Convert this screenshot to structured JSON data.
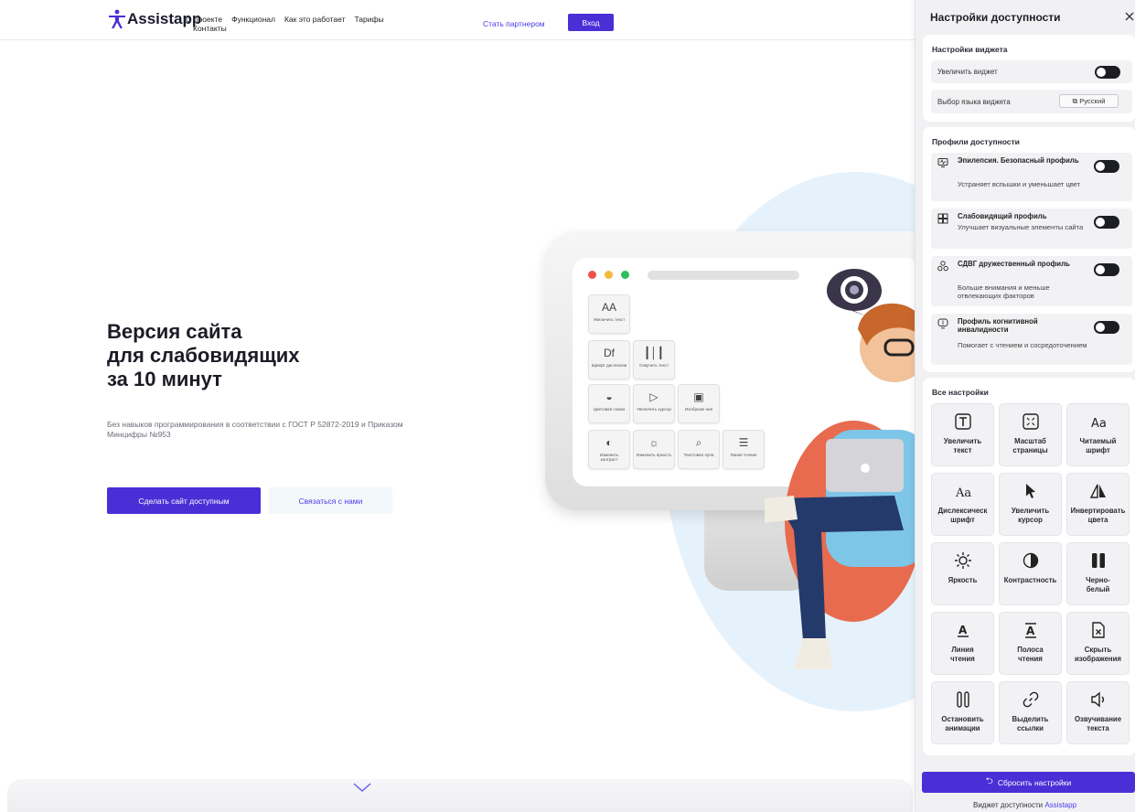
{
  "header": {
    "logo_text": "Assistapp",
    "nav": [
      "О проекте",
      "Функционал",
      "Как это работает",
      "Тарифы"
    ],
    "nav_line2": "Контакты",
    "partner_link": "Стать партнером",
    "login": "Вход"
  },
  "hero": {
    "title_lines": [
      "Версия сайта",
      "для слабовидящих",
      "за 10 минут"
    ],
    "subtitle": "Без навыков программирования в соответствии с ГОСТ Р 52872-2019 и Приказом Минцифры №953",
    "cta_primary": "Сделать сайт доступным",
    "cta_secondary": "Связаться с нами"
  },
  "illustration": {
    "tiles": [
      {
        "glyph": "AA",
        "label": "Увеличить текст"
      },
      {
        "glyph": "Df",
        "label": "Шрифт дислексии"
      },
      {
        "glyph": "┃│┃",
        "label": "Озвучить текст"
      },
      {
        "glyph": "◒",
        "label": "Цветовая схема"
      },
      {
        "glyph": "▷",
        "label": "Увеличить курсор"
      },
      {
        "glyph": "▣",
        "label": "Изображе ния"
      },
      {
        "glyph": "◐",
        "label": "Изменить контраст"
      },
      {
        "glyph": "☼",
        "label": "Изменить яркость"
      },
      {
        "glyph": "⌕",
        "label": "Текстовая лупа"
      },
      {
        "glyph": "☰",
        "label": "Линия чтения"
      }
    ]
  },
  "panel": {
    "title": "Настройки доступности",
    "widget_section": {
      "title": "Настройки виджета",
      "enlarge_label": "Увеличить виджет",
      "language_label": "Выбор языка виджета",
      "language_value": "Русский"
    },
    "profiles_section": {
      "title": "Профили доступности",
      "profiles": [
        {
          "name": "Эпилепсия. Безопасный профиль",
          "desc": "Устраняет вспышки и уменьшает цвет",
          "icon": "monitor-pulse-icon"
        },
        {
          "name": "Слабовидящий профиль",
          "desc": "Улучшает визуальные элементы сайта",
          "icon": "layout-icon"
        },
        {
          "name": "СДВГ дружественный профиль",
          "desc": "Больше внимания и меньше отвлекающих факторов",
          "icon": "cluster-icon"
        },
        {
          "name": "Профиль когнитивной инвалидности",
          "desc": "Помогает с чтением и сосредоточением",
          "icon": "brain-monitor-icon"
        }
      ]
    },
    "all_settings": {
      "title": "Все настройки",
      "tiles": [
        {
          "label": "Увеличить\nтекст",
          "icon": "text-size-icon"
        },
        {
          "label": "Масштаб\nстраницы",
          "icon": "scale-icon"
        },
        {
          "label": "Читаемый\nшрифт",
          "icon": "readable-font-icon"
        },
        {
          "label": "Дислексическ\nшрифт",
          "icon": "dyslexia-font-icon"
        },
        {
          "label": "Увеличить\nкурсор",
          "icon": "cursor-icon"
        },
        {
          "label": "Инвертировать\nцвета",
          "icon": "invert-icon"
        },
        {
          "label": "Яркость",
          "icon": "brightness-icon"
        },
        {
          "label": "Контрастность",
          "icon": "contrast-icon"
        },
        {
          "label": "Черно-\nбелый",
          "icon": "grayscale-icon"
        },
        {
          "label": "Линия\nчтения",
          "icon": "reading-line-icon"
        },
        {
          "label": "Полоса\nчтения",
          "icon": "reading-strip-icon"
        },
        {
          "label": "Скрыть\nизображения",
          "icon": "hide-images-icon"
        },
        {
          "label": "Остановить\nанимации",
          "icon": "pause-icon"
        },
        {
          "label": "Выделить\nссылки",
          "icon": "link-icon"
        },
        {
          "label": "Озвучивание\nтекста",
          "icon": "speaker-icon"
        }
      ]
    },
    "reset": "Сбросить настройки",
    "footer_prefix": "Виджет доступности",
    "footer_brand": "Assistapp"
  },
  "colors": {
    "accent": "#4a2fd6",
    "panel_bg": "#f1f1f4",
    "blob": "#e6f2fb"
  }
}
